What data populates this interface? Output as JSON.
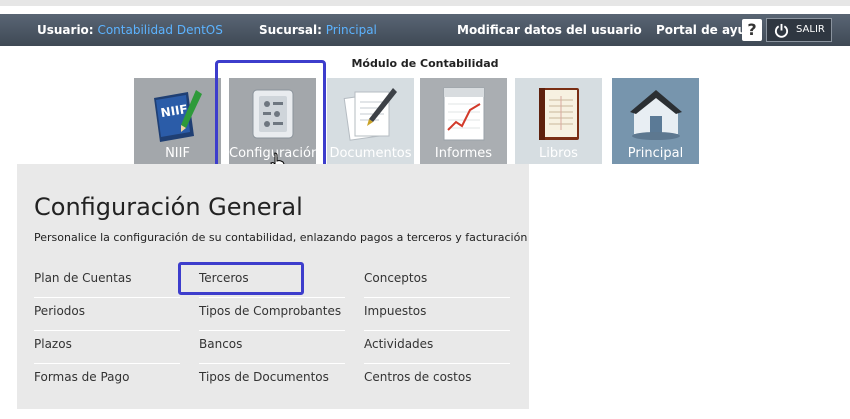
{
  "header": {
    "usuario_label": "Usuario:",
    "usuario_value": "Contabilidad DentOS",
    "sucursal_label": "Sucursal:",
    "sucursal_value": "Principal",
    "modify_link": "Modificar datos del usuario",
    "help_link": "Portal de ayuda",
    "help_icon": "?",
    "logout_label": "SALIR"
  },
  "module": {
    "title": "Módulo de Contabilidad",
    "tiles": [
      {
        "label": "NIIF",
        "icon": "niif-book-icon"
      },
      {
        "label": "Configuración",
        "icon": "settings-panel-icon"
      },
      {
        "label": "Documentos",
        "icon": "documents-pen-icon"
      },
      {
        "label": "Informes",
        "icon": "report-chart-icon"
      },
      {
        "label": "Libros",
        "icon": "ledger-book-icon"
      },
      {
        "label": "Principal",
        "icon": "home-icon"
      }
    ]
  },
  "panel": {
    "title": "Configuración General",
    "subtitle": "Personalice la configuración de su contabilidad, enlazando pagos a terceros y facturación",
    "col1": [
      "Plan de Cuentas",
      "Periodos",
      "Plazos",
      "Formas de Pago"
    ],
    "col2": [
      "Terceros",
      "Tipos de Comprobantes",
      "Bancos",
      "Tipos de Documentos"
    ],
    "col3": [
      "Conceptos",
      "Impuestos",
      "Actividades",
      "Centros de costos"
    ]
  },
  "colors": {
    "header_bg": "#4a5562",
    "link_blue": "#5cb3ff",
    "highlight": "#3d3dcc",
    "panel_bg": "#e9e9e9"
  }
}
